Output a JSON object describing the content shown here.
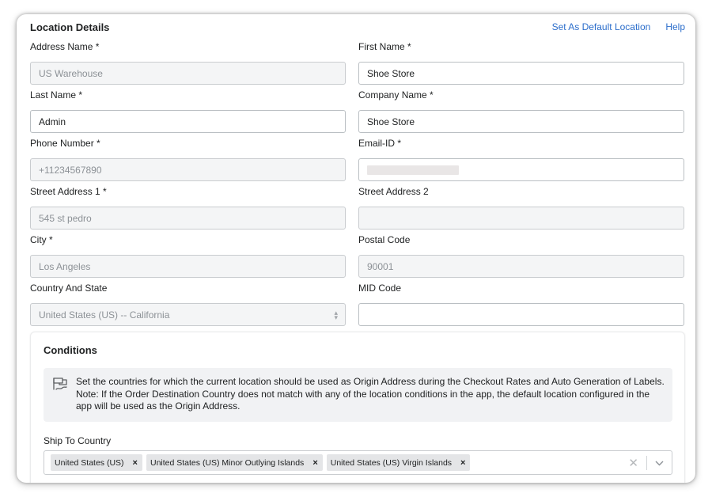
{
  "header": {
    "title": "Location Details",
    "set_default_label": "Set As Default Location",
    "help_label": "Help"
  },
  "fields": {
    "address_name": {
      "label": "Address Name *",
      "value": "US Warehouse"
    },
    "first_name": {
      "label": "First Name *",
      "value": "Shoe Store"
    },
    "last_name": {
      "label": "Last Name *",
      "value": "Admin"
    },
    "company_name": {
      "label": "Company Name *",
      "value": "Shoe Store"
    },
    "phone": {
      "label": "Phone Number *",
      "value": "+11234567890"
    },
    "email": {
      "label": "Email-ID *",
      "value": ""
    },
    "street1": {
      "label": "Street Address 1 *",
      "value": "545 st pedro"
    },
    "street2": {
      "label": "Street Address 2",
      "value": ""
    },
    "city": {
      "label": "City *",
      "value": "Los Angeles"
    },
    "postal": {
      "label": "Postal Code",
      "value": "90001"
    },
    "country_state": {
      "label": "Country And State",
      "value": "United States (US) -- California"
    },
    "mid_code": {
      "label": "MID Code",
      "value": ""
    }
  },
  "conditions": {
    "title": "Conditions",
    "banner_text": "Set the countries for which the current location should be used as Origin Address during the Checkout Rates and Auto Generation of Labels. Note: If the Order Destination Country does not match with any of the location conditions in the app, the default location configured in the app will be used as the Origin Address.",
    "ship_to_label": "Ship To Country",
    "tags": [
      {
        "label": "United States (US)"
      },
      {
        "label": "United States (US) Minor Outlying Islands"
      },
      {
        "label": "United States (US) Virgin Islands"
      }
    ]
  },
  "icons": {
    "banner_icon": "flag-route-icon",
    "tag_remove": "×",
    "clear": "✕",
    "dropdown": "chevron-down-icon"
  },
  "colors": {
    "link": "#2c6ecb",
    "disabled_bg": "#f4f5f6",
    "banner_bg": "#f1f2f4"
  }
}
